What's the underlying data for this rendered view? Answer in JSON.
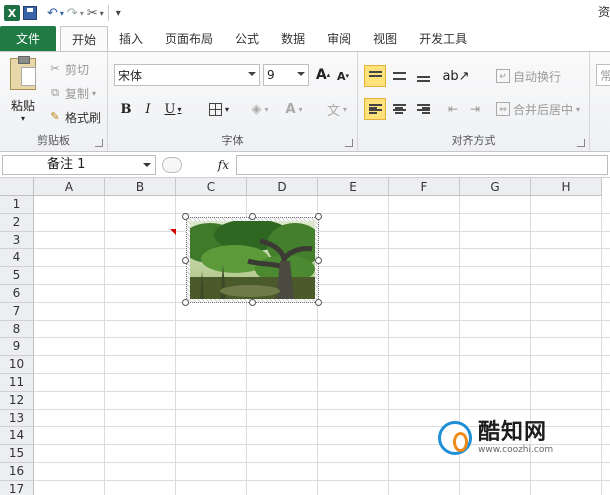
{
  "app": {
    "title_fragment": "资"
  },
  "qat": {
    "logo_letter": "X",
    "save": "save-icon",
    "undo": "undo-icon",
    "redo": "redo-icon",
    "tools": "tools-icon"
  },
  "tabs": [
    "文件",
    "开始",
    "插入",
    "页面布局",
    "公式",
    "数据",
    "审阅",
    "视图",
    "开发工具"
  ],
  "ribbon": {
    "clipboard": {
      "paste": "粘贴",
      "cut": "剪切",
      "copy": "复制",
      "format_painter": "格式刷",
      "label": "剪贴板"
    },
    "font": {
      "font_name": "宋体",
      "font_size": "9",
      "bold": "B",
      "italic": "I",
      "underline": "U",
      "grow": "A",
      "shrink": "A",
      "label": "字体"
    },
    "alignment": {
      "wrap_text": "自动换行",
      "merge_center": "合并后居中",
      "label": "对齐方式"
    },
    "number": {
      "partial": "常"
    }
  },
  "formula_bar": {
    "name_box": "备注 1",
    "fx": "fx",
    "value": ""
  },
  "grid": {
    "columns": [
      "A",
      "B",
      "C",
      "D",
      "E",
      "F",
      "G",
      "H"
    ],
    "rows": [
      "1",
      "2",
      "3",
      "4",
      "5",
      "6",
      "7",
      "8",
      "9",
      "10",
      "11",
      "12",
      "13",
      "14",
      "15",
      "16",
      "17"
    ]
  },
  "watermark": {
    "title": "酷知网",
    "url": "www.coozhi.com"
  }
}
